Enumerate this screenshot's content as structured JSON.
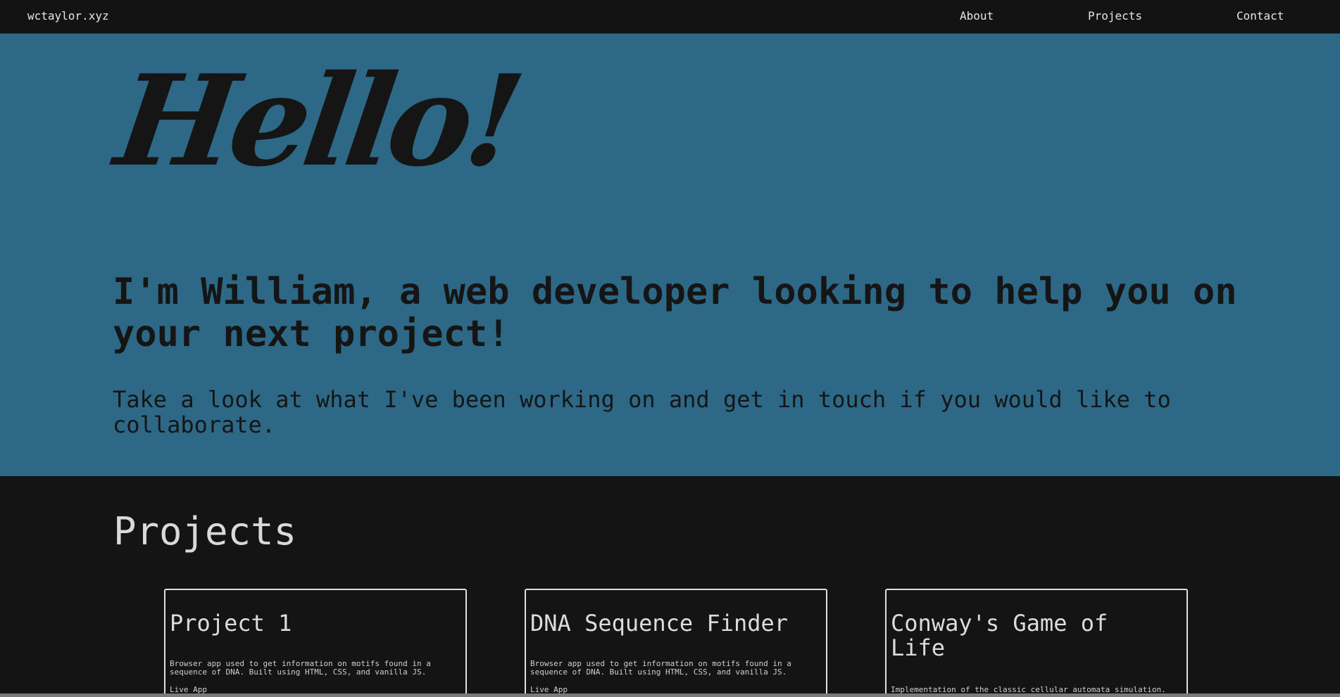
{
  "nav": {
    "brand": "wctaylor.xyz",
    "links": [
      "About",
      "Projects",
      "Contact"
    ]
  },
  "hero": {
    "greeting": "Hello!",
    "headline": "I'm William, a web developer looking to help you on your next project!",
    "subline": "Take a look at what I've been working on and get in touch if you would like to collaborate."
  },
  "projects": {
    "title": "Projects",
    "cards": [
      {
        "title": "Project 1",
        "description": "Browser app used to get information on motifs found in a sequence of DNA. Built using HTML, CSS, and vanilla JS.",
        "link": "Live App"
      },
      {
        "title": "DNA Sequence Finder",
        "description": "Browser app used to get information on motifs found in a sequence of DNA. Built using HTML, CSS, and vanilla JS.",
        "link": "Live App"
      },
      {
        "title": "Conway's Game of Life",
        "description": "Implementation of the classic cellular automata simulation."
      }
    ]
  },
  "colors": {
    "nav_bg": "#131313",
    "hero_bg": "#2d6886",
    "dark_text": "#151515",
    "section_bg": "#141414",
    "light_text": "#dcdcdc"
  }
}
